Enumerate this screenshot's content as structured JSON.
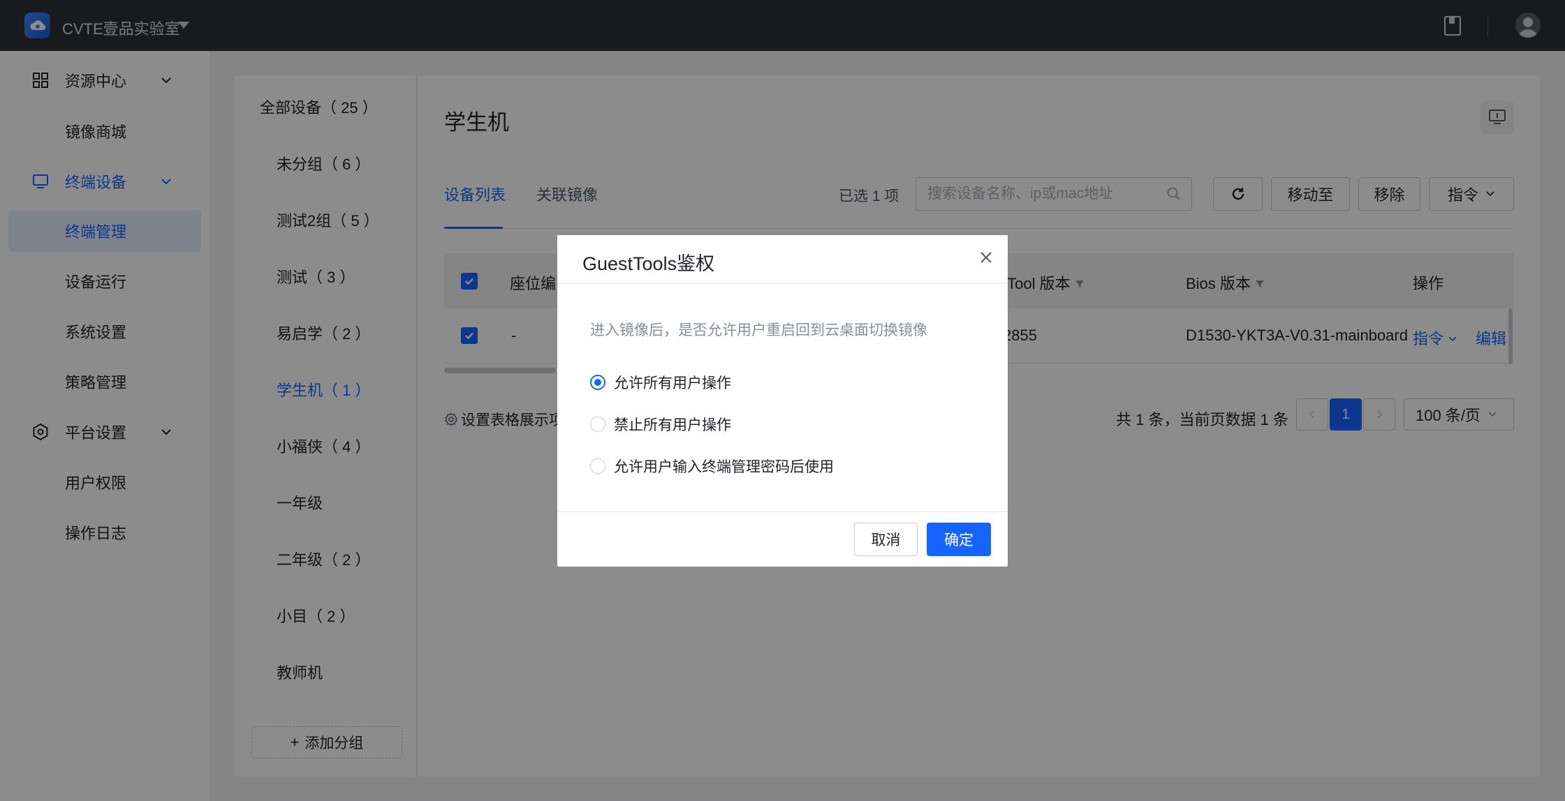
{
  "topbar": {
    "org_name": "CVTE壹品实验室",
    "icons": [
      "cloud-logo-icon",
      "caret-down-icon",
      "book-icon",
      "user-avatar-icon"
    ]
  },
  "sidebar": {
    "items": [
      {
        "label": "资源中心",
        "icon": "grid-icon",
        "expandable": true
      },
      {
        "label": "镜像商城"
      },
      {
        "label": "终端设备",
        "icon": "monitor-icon",
        "expandable": true
      },
      {
        "label": "终端管理"
      },
      {
        "label": "设备运行"
      },
      {
        "label": "系统设置"
      },
      {
        "label": "策略管理"
      },
      {
        "label": "平台设置",
        "icon": "settings-icon",
        "expandable": true
      },
      {
        "label": "用户权限"
      },
      {
        "label": "操作日志"
      }
    ]
  },
  "groups": {
    "items": [
      {
        "label": "全部设备（ 25 ）"
      },
      {
        "label": "未分组（ 6 ）"
      },
      {
        "label": "测试2组（ 5 ）"
      },
      {
        "label": "测试（ 3 ）"
      },
      {
        "label": "易启学（ 2 ）"
      },
      {
        "label": "学生机（ 1 ）"
      },
      {
        "label": "小福侠（ 4 ）"
      },
      {
        "label": "一年级"
      },
      {
        "label": "二年级（ 2 ）"
      },
      {
        "label": "小目（ 2 ）"
      },
      {
        "label": "教师机"
      }
    ],
    "add_label": "添加分组"
  },
  "main": {
    "title": "学生机",
    "tabs": [
      {
        "label": "设备列表"
      },
      {
        "label": "关联镜像"
      }
    ],
    "selected_count": "已选 1 项",
    "search_placeholder": "搜索设备名称、ip或mac地址",
    "buttons": {
      "move_to": "移动至",
      "remove": "移除",
      "command": "指令"
    },
    "table": {
      "headers": {
        "seat": "座位编",
        "guesttool": "tTool 版本",
        "bios": "Bios 版本",
        "ops": "操作"
      },
      "row": {
        "seat": "-",
        "guesttool": "2855",
        "bios": "D1530-YKT3A-V0.31-mainboard",
        "cmd": "指令",
        "edit": "编辑"
      }
    },
    "settings_link": "设置表格展示项",
    "pagination": {
      "summary": "共 1 条，当前页数据 1 条",
      "current_page": "1",
      "page_size": "100 条/页"
    }
  },
  "modal": {
    "title": "GuestTools鉴权",
    "description": "进入镜像后，是否允许用户重启回到云桌面切换镜像",
    "options": [
      {
        "label": "允许所有用户操作",
        "selected": true
      },
      {
        "label": "禁止所有用户操作",
        "selected": false
      },
      {
        "label": "允许用户输入终端管理密码后使用",
        "selected": false
      }
    ],
    "cancel_label": "取消",
    "ok_label": "确定"
  },
  "colors": {
    "accent": "#1664ff",
    "topbar": "#2f3135",
    "mask": "rgba(0,0,0,0.45)"
  }
}
